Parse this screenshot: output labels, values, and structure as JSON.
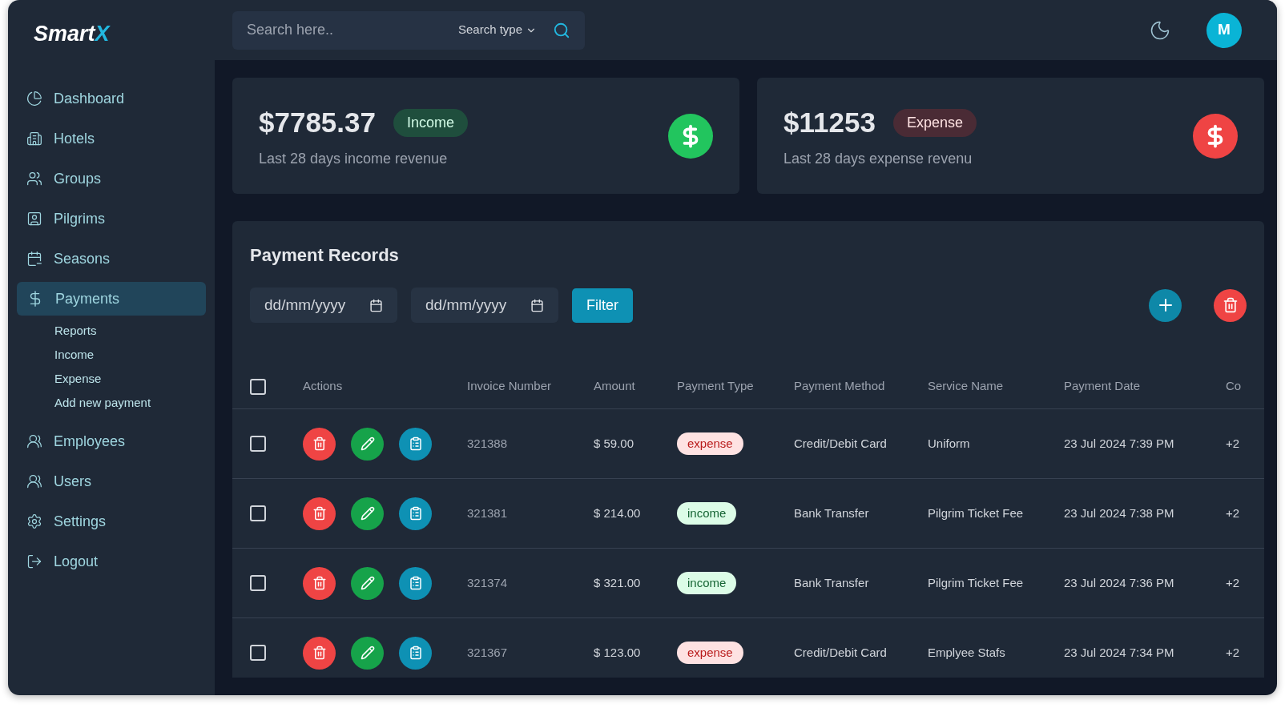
{
  "brand": {
    "name": "Smart",
    "accent": "X"
  },
  "search": {
    "placeholder": "Search here..",
    "type_label": "Search type"
  },
  "avatar": "M",
  "sidebar": [
    {
      "label": "Dashboard",
      "selected": false
    },
    {
      "label": "Hotels",
      "selected": false
    },
    {
      "label": "Groups",
      "selected": false
    },
    {
      "label": "Pilgrims",
      "selected": false
    },
    {
      "label": "Seasons",
      "selected": false
    },
    {
      "label": "Payments",
      "selected": true,
      "children": [
        {
          "label": "Reports"
        },
        {
          "label": "Income"
        },
        {
          "label": "Expense"
        },
        {
          "label": "Add new payment"
        }
      ]
    },
    {
      "label": "Employees",
      "selected": false
    },
    {
      "label": "Users",
      "selected": false
    },
    {
      "label": "Settings",
      "selected": false
    },
    {
      "label": "Logout",
      "selected": false
    }
  ],
  "stats": [
    {
      "kind": "income",
      "amount": "$7785.37",
      "tag": "Income",
      "caption": "Last 28 days income revenue"
    },
    {
      "kind": "expense",
      "amount": "$11253",
      "tag": "Expense",
      "caption": "Last 28 days expense revenu"
    }
  ],
  "payments": {
    "title": "Payment Records",
    "date_fields": [
      {
        "placeholder": "dd/mm/yyyy"
      },
      {
        "placeholder": "dd/mm/yyyy"
      }
    ],
    "filter_button": "Filter",
    "table": {
      "all_checked": false,
      "columns": [
        "Actions",
        "Invoice Number",
        "Amount",
        "Payment Type",
        "Payment Method",
        "Service Name",
        "Payment Date",
        "Co"
      ],
      "rows": [
        {
          "checked": false,
          "invoice": "321388",
          "amount": "$ 59.00",
          "type": {
            "label": "expense",
            "kind": "expense"
          },
          "method": "Credit/Debit Card",
          "service": "Uniform",
          "date": "23 Jul 2024 7:39 PM",
          "column_9": "+2"
        },
        {
          "checked": false,
          "invoice": "321381",
          "amount": "$ 214.00",
          "type": {
            "label": "income",
            "kind": "income"
          },
          "method": "Bank Transfer",
          "service": "Pilgrim Ticket Fee",
          "date": "23 Jul 2024 7:38 PM",
          "column_9": "+2"
        },
        {
          "checked": false,
          "invoice": "321374",
          "amount": "$ 321.00",
          "type": {
            "label": "income",
            "kind": "income"
          },
          "method": "Bank Transfer",
          "service": "Pilgrim Ticket Fee",
          "date": "23 Jul 2024 7:36 PM",
          "column_9": "+2"
        },
        {
          "checked": false,
          "invoice": "321367",
          "amount": "$ 123.00",
          "type": {
            "label": "expense",
            "kind": "expense"
          },
          "method": "Credit/Debit Card",
          "service": "Emplyee Stafs",
          "date": "23 Jul 2024 7:34 PM",
          "column_9": "+2"
        }
      ]
    }
  }
}
